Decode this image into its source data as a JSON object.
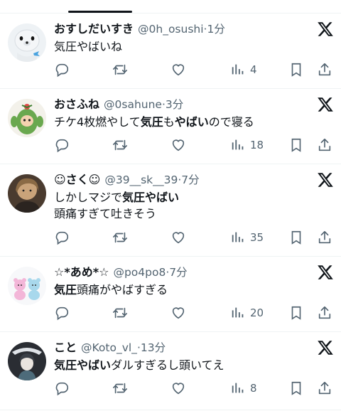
{
  "tab": {
    "active_indicator_color": "#0f1419"
  },
  "posts": [
    {
      "name": "おすしだいすき",
      "handle": "@0h_osushi",
      "time": "·1分",
      "text_parts": [
        {
          "t": "気圧やばいね",
          "b": false
        }
      ],
      "views": "4",
      "avatar_icon": "seal-avatar-icon"
    },
    {
      "name": "おさふね",
      "handle": "@0sahune",
      "time": "·3分",
      "text_parts": [
        {
          "t": "チケ4枚燃やして",
          "b": false
        },
        {
          "t": "気圧",
          "b": true
        },
        {
          "t": "も",
          "b": false
        },
        {
          "t": "やばい",
          "b": true
        },
        {
          "t": "ので寝る",
          "b": false
        }
      ],
      "views": "18",
      "avatar_icon": "cactus-avatar-icon"
    },
    {
      "name": "☺︎さく☺︎",
      "handle": "@39__sk__39",
      "time": "·7分",
      "text_parts": [
        {
          "t": "しかしマジで",
          "b": false
        },
        {
          "t": "気圧やばい",
          "b": true
        },
        {
          "t": "\n頭痛すぎて吐きそう",
          "b": false
        }
      ],
      "views": "35",
      "avatar_icon": "person-avatar-icon"
    },
    {
      "name": "☆*あめ*☆",
      "handle": "@po4po8",
      "time": "·7分",
      "text_parts": [
        {
          "t": "気圧",
          "b": true
        },
        {
          "t": "頭痛がやばすぎる",
          "b": false
        }
      ],
      "views": "20",
      "avatar_icon": "bears-avatar-icon"
    },
    {
      "name": "こと",
      "handle": "@Koto_vl_",
      "time": "·13分",
      "text_parts": [
        {
          "t": "気圧やばい",
          "b": true
        },
        {
          "t": "ダルすぎるし頭いてえ",
          "b": false
        }
      ],
      "views": "8",
      "avatar_icon": "anime-avatar-icon"
    }
  ]
}
